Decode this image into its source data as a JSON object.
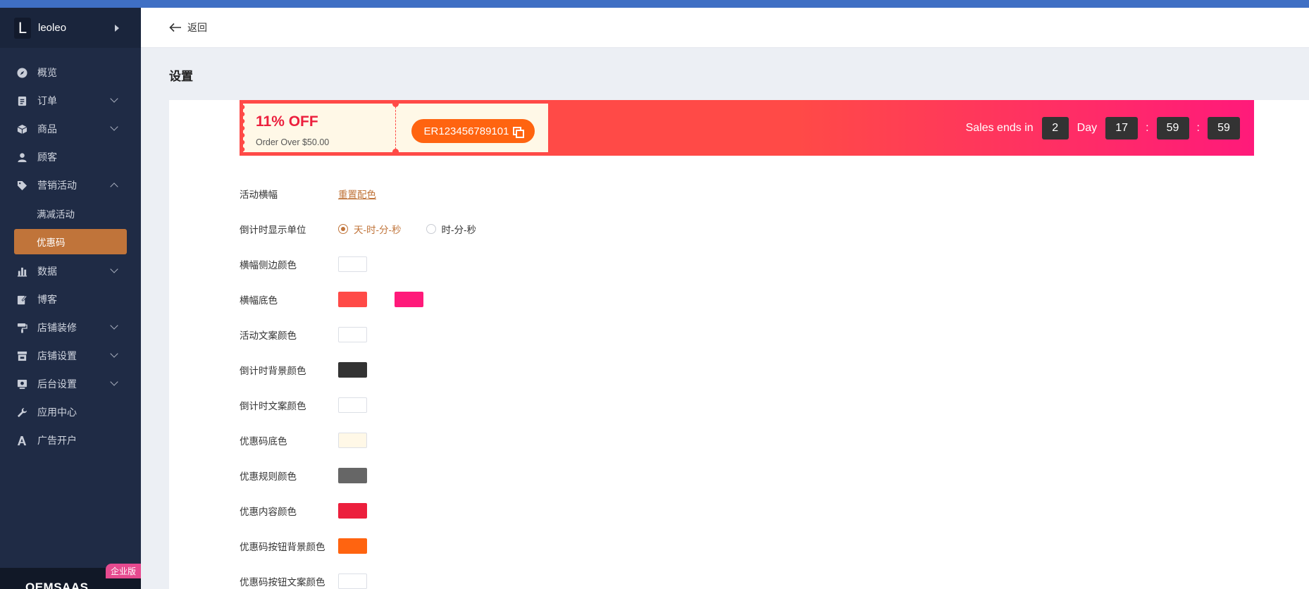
{
  "sidebar": {
    "brand": {
      "initial": "L",
      "name": "leoleo"
    },
    "menu": [
      {
        "label": "概览",
        "icon": "compass-icon"
      },
      {
        "label": "订单",
        "icon": "clipboard-icon"
      },
      {
        "label": "商品",
        "icon": "box-icon"
      },
      {
        "label": "顾客",
        "icon": "user-icon"
      },
      {
        "label": "营销活动",
        "icon": "tag-icon"
      },
      {
        "label": "满减活动"
      },
      {
        "label": "优惠码"
      },
      {
        "label": "数据",
        "icon": "bar-chart-icon"
      },
      {
        "label": "博客",
        "icon": "edit-icon"
      },
      {
        "label": "店铺装修",
        "icon": "paint-roller-icon"
      },
      {
        "label": "店铺设置",
        "icon": "store-icon"
      },
      {
        "label": "后台设置",
        "icon": "monitor-icon"
      },
      {
        "label": "应用中心",
        "icon": "wrench-icon"
      },
      {
        "label": "广告开户",
        "icon": "ads-icon"
      }
    ],
    "footer": {
      "logo": "OEMSAAS",
      "badge": "企业版"
    }
  },
  "header": {
    "back_label": "返回"
  },
  "page": {
    "title": "设置"
  },
  "banner": {
    "discount": "11% OFF",
    "rule": "Order Over $50.00",
    "code": "ER123456789101",
    "countdown_prefix": "Sales ends in",
    "days": "2",
    "day_label": "Day",
    "hours": "17",
    "minutes": "59",
    "seconds": "59",
    "colon": ":"
  },
  "form": {
    "banner_label": "活动横幅",
    "reset_link": "重置配色",
    "unit_label": "倒计时显示单位",
    "unit_options": [
      "天-时-分-秒",
      "时-分-秒"
    ],
    "rows": [
      {
        "label": "横幅侧边颜色",
        "colors": [
          "#ffffff"
        ]
      },
      {
        "label": "横幅底色",
        "colors": [
          "#ff4a47",
          "#ff1a7a"
        ]
      },
      {
        "label": "活动文案颜色",
        "colors": [
          "#ffffff"
        ]
      },
      {
        "label": "倒计时背景颜色",
        "colors": [
          "#333333"
        ]
      },
      {
        "label": "倒计时文案颜色",
        "colors": [
          "#ffffff"
        ]
      },
      {
        "label": "优惠码底色",
        "colors": [
          "#fff8e7"
        ]
      },
      {
        "label": "优惠规则颜色",
        "colors": [
          "#666666"
        ]
      },
      {
        "label": "优惠内容颜色",
        "colors": [
          "#ec1f3d"
        ]
      },
      {
        "label": "优惠码按钮背景颜色",
        "colors": [
          "#ff6410"
        ]
      },
      {
        "label": "优惠码按钮文案颜色",
        "colors": [
          "#ffffff"
        ]
      }
    ]
  }
}
